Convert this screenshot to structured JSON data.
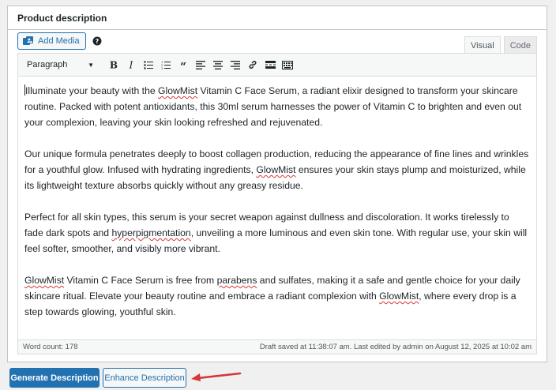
{
  "panel": {
    "title": "Product description"
  },
  "media": {
    "add_media_label": "Add Media"
  },
  "tabs": [
    {
      "label": "Visual"
    },
    {
      "label": "Code"
    }
  ],
  "toolbar": {
    "format_value": "Paragraph",
    "buttons": [
      "bold-icon",
      "italic-icon",
      "bullet-list-icon",
      "numbered-list-icon",
      "blockquote-icon",
      "align-left-icon",
      "align-center-icon",
      "align-right-icon",
      "link-icon",
      "read-more-icon",
      "toolbar-toggle-icon"
    ]
  },
  "content": {
    "paragraphs": [
      [
        {
          "t": "Illuminate your beauty with the "
        },
        {
          "t": "GlowMist",
          "sp": true
        },
        {
          "t": " Vitamin C Face Serum, a radiant elixir designed to transform your skincare routine. Packed with potent antioxidants, this 30ml serum harnesses the power of Vitamin C to brighten and even out your complexion, leaving your skin looking refreshed and rejuvenated."
        }
      ],
      [
        {
          "t": "Our unique formula penetrates deeply to boost collagen production, reducing the appearance of fine lines and wrinkles for a youthful glow. Infused with hydrating ingredients, "
        },
        {
          "t": "GlowMist",
          "sp": true
        },
        {
          "t": " ensures your skin stays plump and moisturized, while its lightweight texture absorbs quickly without any greasy residue."
        }
      ],
      [
        {
          "t": "Perfect for all skin types, this serum is your secret weapon against dullness and discoloration. It works tirelessly to fade dark spots and "
        },
        {
          "t": "hyperpigmentation",
          "sp": true
        },
        {
          "t": ", unveiling a more luminous and even skin tone. With regular use, your skin will feel softer, smoother, and visibly more vibrant."
        }
      ],
      [
        {
          "t": "GlowMist",
          "sp": true
        },
        {
          "t": " Vitamin C Face Serum is free from "
        },
        {
          "t": "parabens",
          "sp": true
        },
        {
          "t": " and sulfates, making it a safe and gentle choice for your daily skincare ritual. Elevate your beauty routine and embrace a radiant complexion with "
        },
        {
          "t": "GlowMist",
          "sp": true
        },
        {
          "t": ", where every drop is a step towards glowing, youthful skin."
        }
      ]
    ]
  },
  "status": {
    "word_count": "Word count: 178",
    "draft_saved": "Draft saved at 11:38:07 am. Last edited by admin on August 12, 2025 at 10:02 am"
  },
  "actions": {
    "generate_label": "Generate Description",
    "enhance_label": "Enhance Description"
  },
  "colors": {
    "accent": "#2271b1",
    "arrow": "#d63638"
  }
}
